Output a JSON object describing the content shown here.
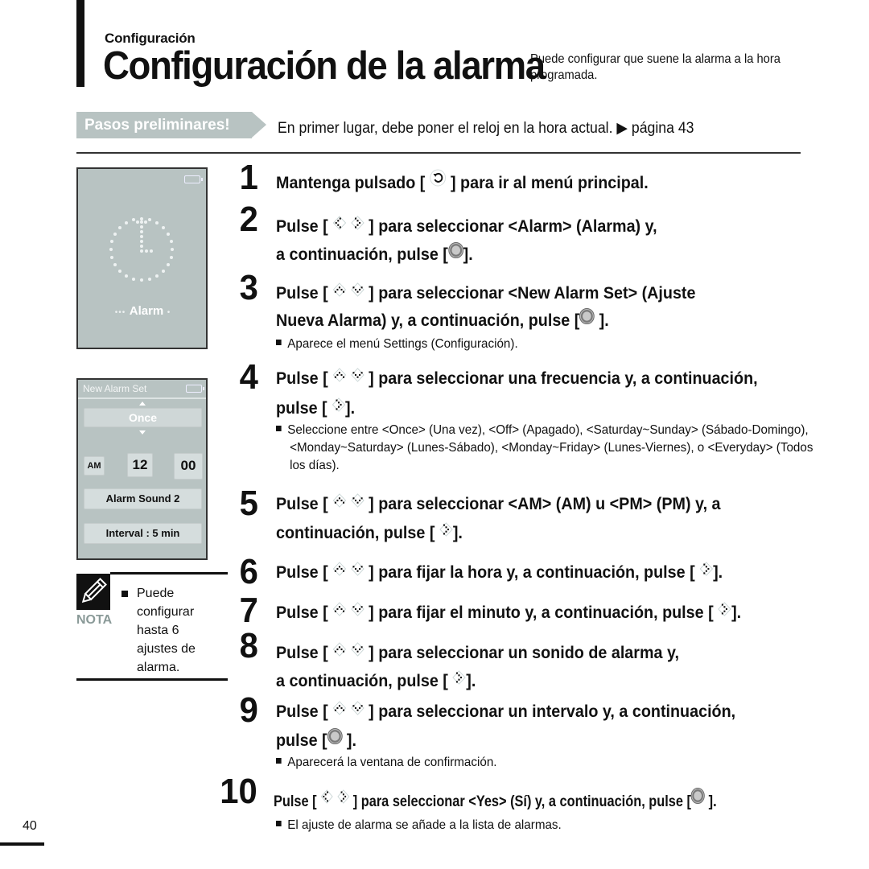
{
  "header": {
    "section": "Configuración",
    "title": "Configuración de la alarma",
    "subtitle": "Puede configurar que suene la alarma a la hora programada."
  },
  "prelim": {
    "badge": "Pasos preliminares!",
    "text": "En primer lugar, debe poner el reloj en la hora actual. ▶ página 43"
  },
  "screen1": {
    "label": "Alarm",
    "icon": "alarm-clock-icon"
  },
  "screen2": {
    "header": "New Alarm Set",
    "frequency": "Once",
    "ampm": "AM",
    "hour": "12",
    "minute": "00",
    "sound": "Alarm Sound 2",
    "interval": "Interval : 5 min"
  },
  "note": {
    "label": "NOTA",
    "icon": "pencil-icon",
    "text": "Puede configurar hasta 6 ajustes de alarma."
  },
  "steps": [
    {
      "num": "1",
      "lines": [
        [
          "Mantenga pulsado [ ",
          "back-icon",
          " ] para ir al menú principal."
        ]
      ]
    },
    {
      "num": "2",
      "lines": [
        [
          "Pulse [ ",
          "left-right-icon",
          " ] para seleccionar <Alarm> (Alarma) y,"
        ],
        [
          "a continuación, pulse [",
          "ok-button-icon",
          "]."
        ]
      ]
    },
    {
      "num": "3",
      "lines": [
        [
          "Pulse [ ",
          "up-down-icon",
          " ] para seleccionar <New Alarm Set> (Ajuste"
        ],
        [
          "Nueva Alarma) y, a continuación, pulse [",
          "ok-button-icon",
          " ]."
        ]
      ],
      "bullet": "Aparece el menú Settings (Configuración)."
    },
    {
      "num": "4",
      "lines": [
        [
          "Pulse [ ",
          "up-down-icon",
          " ] para seleccionar una frecuencia y, a continuación,"
        ],
        [
          "pulse [ ",
          "right-icon",
          "]."
        ]
      ],
      "bullet": "Seleccione entre <Once> (Una vez), <Off> (Apagado), <Saturday~Sunday> (Sábado-Domingo), <Monday~Saturday> (Lunes-Sábado), <Monday~Friday> (Lunes-Viernes), o <Everyday> (Todos los días)."
    },
    {
      "num": "5",
      "lines": [
        [
          "Pulse [ ",
          "up-down-icon",
          " ] para seleccionar <AM> (AM) u <PM> (PM) y, a"
        ],
        [
          "continuación, pulse [ ",
          "right-icon",
          "]."
        ]
      ]
    },
    {
      "num": "6",
      "lines": [
        [
          "Pulse [ ",
          "up-down-icon",
          " ] para fijar la hora y, a continuación, pulse [ ",
          "right-icon",
          "]."
        ]
      ]
    },
    {
      "num": "7",
      "lines": [
        [
          "Pulse [ ",
          "up-down-icon",
          " ] para fijar el minuto y, a continuación, pulse [ ",
          "right-icon",
          "]."
        ]
      ]
    },
    {
      "num": "8",
      "lines": [
        [
          "Pulse [ ",
          "up-down-icon",
          " ] para seleccionar un sonido de alarma y,"
        ],
        [
          "a continuación, pulse [ ",
          "right-icon",
          "]."
        ]
      ]
    },
    {
      "num": "9",
      "lines": [
        [
          "Pulse [ ",
          "up-down-icon",
          " ] para seleccionar un intervalo y, a continuación,"
        ],
        [
          "pulse [",
          "ok-button-icon",
          " ]."
        ]
      ],
      "bullet": "Aparecerá la ventana de confirmación."
    },
    {
      "num": "10",
      "lines": [
        [
          "Pulse [ ",
          "left-right-icon",
          " ] para seleccionar <Yes> (Sí) y, a continuación, pulse [",
          "ok-button-icon",
          " ]."
        ]
      ],
      "bullet": "El ajuste de alarma se añade a la lista de alarmas."
    }
  ],
  "page_number": "40"
}
